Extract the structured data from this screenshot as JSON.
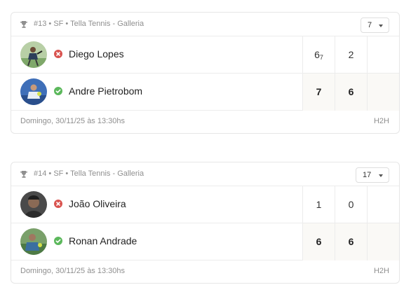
{
  "matches": [
    {
      "header": "#13 • SF • Tella Tennis - Galleria",
      "round_value": "7",
      "players": [
        {
          "name": "Diego Lopes",
          "status": "lost",
          "sets": [
            "6",
            "2",
            ""
          ],
          "tiebreak": [
            "7",
            "",
            ""
          ]
        },
        {
          "name": "Andre Pietrobom",
          "status": "won",
          "sets": [
            "7",
            "6",
            ""
          ],
          "tiebreak": [
            "",
            "",
            ""
          ]
        }
      ],
      "date": "Domingo, 30/11/25 às 13:30hs",
      "h2h": "H2H"
    },
    {
      "header": "#14 • SF • Tella Tennis - Galleria",
      "round_value": "17",
      "players": [
        {
          "name": "João Oliveira",
          "status": "lost",
          "sets": [
            "1",
            "0",
            ""
          ],
          "tiebreak": [
            "",
            "",
            ""
          ]
        },
        {
          "name": "Ronan Andrade",
          "status": "won",
          "sets": [
            "6",
            "6",
            ""
          ],
          "tiebreak": [
            "",
            "",
            ""
          ]
        }
      ],
      "date": "Domingo, 30/11/25 às 13:30hs",
      "h2h": "H2H"
    }
  ],
  "colors": {
    "lost": "#d9534f",
    "won": "#5cb85c"
  },
  "icons": {
    "header": "trophy-icon",
    "lost": "x-circle-icon",
    "won": "check-circle-icon"
  }
}
